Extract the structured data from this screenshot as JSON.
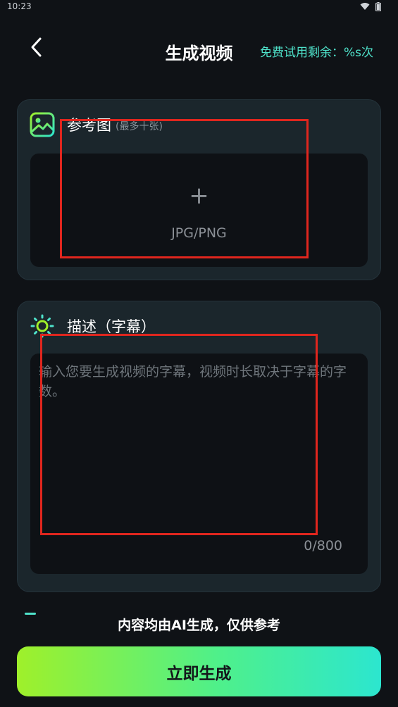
{
  "status_bar": {
    "time": "10:23"
  },
  "header": {
    "title": "生成视频",
    "free_trial": "免费试用剩余：%s次"
  },
  "reference": {
    "title": "参考图",
    "hint": "(最多十张)",
    "plus": "+",
    "format": "JPG/PNG"
  },
  "description": {
    "title": "描述（字幕）",
    "placeholder": "输入您要生成视频的字幕，视频时长取决于字幕的字数。",
    "count": "0/800"
  },
  "footer": {
    "disclaimer": "内容均由AI生成，仅供参考",
    "generate_label": "立即生成"
  },
  "colors": {
    "accent": "#4fe3cb",
    "annotation": "#e0261e",
    "background": "#0f1216"
  }
}
